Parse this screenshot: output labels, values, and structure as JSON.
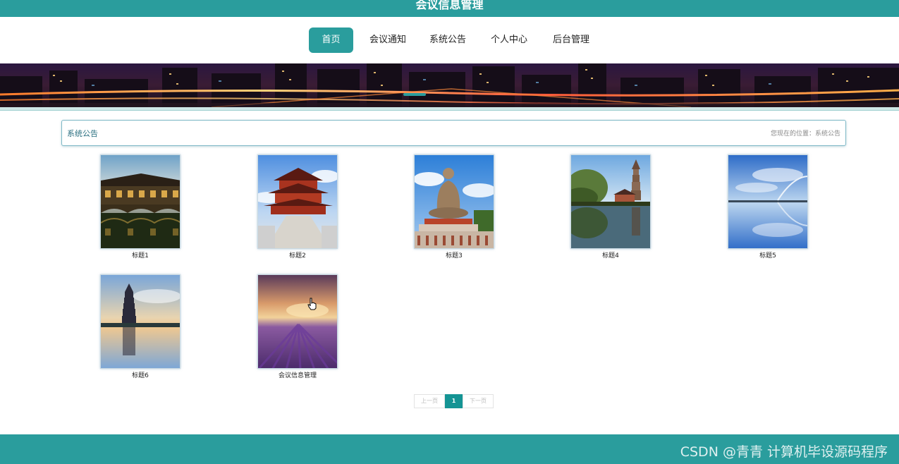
{
  "header": {
    "site_title": "会议信息管理"
  },
  "nav": {
    "items": [
      {
        "label": "首页",
        "active": true
      },
      {
        "label": "会议通知",
        "active": false
      },
      {
        "label": "系统公告",
        "active": false
      },
      {
        "label": "个人中心",
        "active": false
      },
      {
        "label": "后台管理",
        "active": false
      }
    ]
  },
  "section": {
    "title": "系统公告",
    "breadcrumb": "您现在的位置：系统公告"
  },
  "cards": [
    {
      "caption": "标题1",
      "image": "covered-bridge"
    },
    {
      "caption": "标题2",
      "image": "temple-pavilion"
    },
    {
      "caption": "标题3",
      "image": "buddha-statue"
    },
    {
      "caption": "标题4",
      "image": "pagoda-lake"
    },
    {
      "caption": "标题5",
      "image": "bridge-sky-reflection"
    },
    {
      "caption": "标题6",
      "image": "tower-sunset-reflection"
    },
    {
      "caption": "会议信息管理",
      "image": "lavender-field"
    }
  ],
  "pager": {
    "prev_label": "上一页",
    "current": "1",
    "next_label": "下一页"
  },
  "footer": {
    "watermark": "CSDN @青青  计算机毕设源码程序"
  },
  "colors": {
    "accent": "#2a9d9d",
    "pager_active": "#149494"
  }
}
